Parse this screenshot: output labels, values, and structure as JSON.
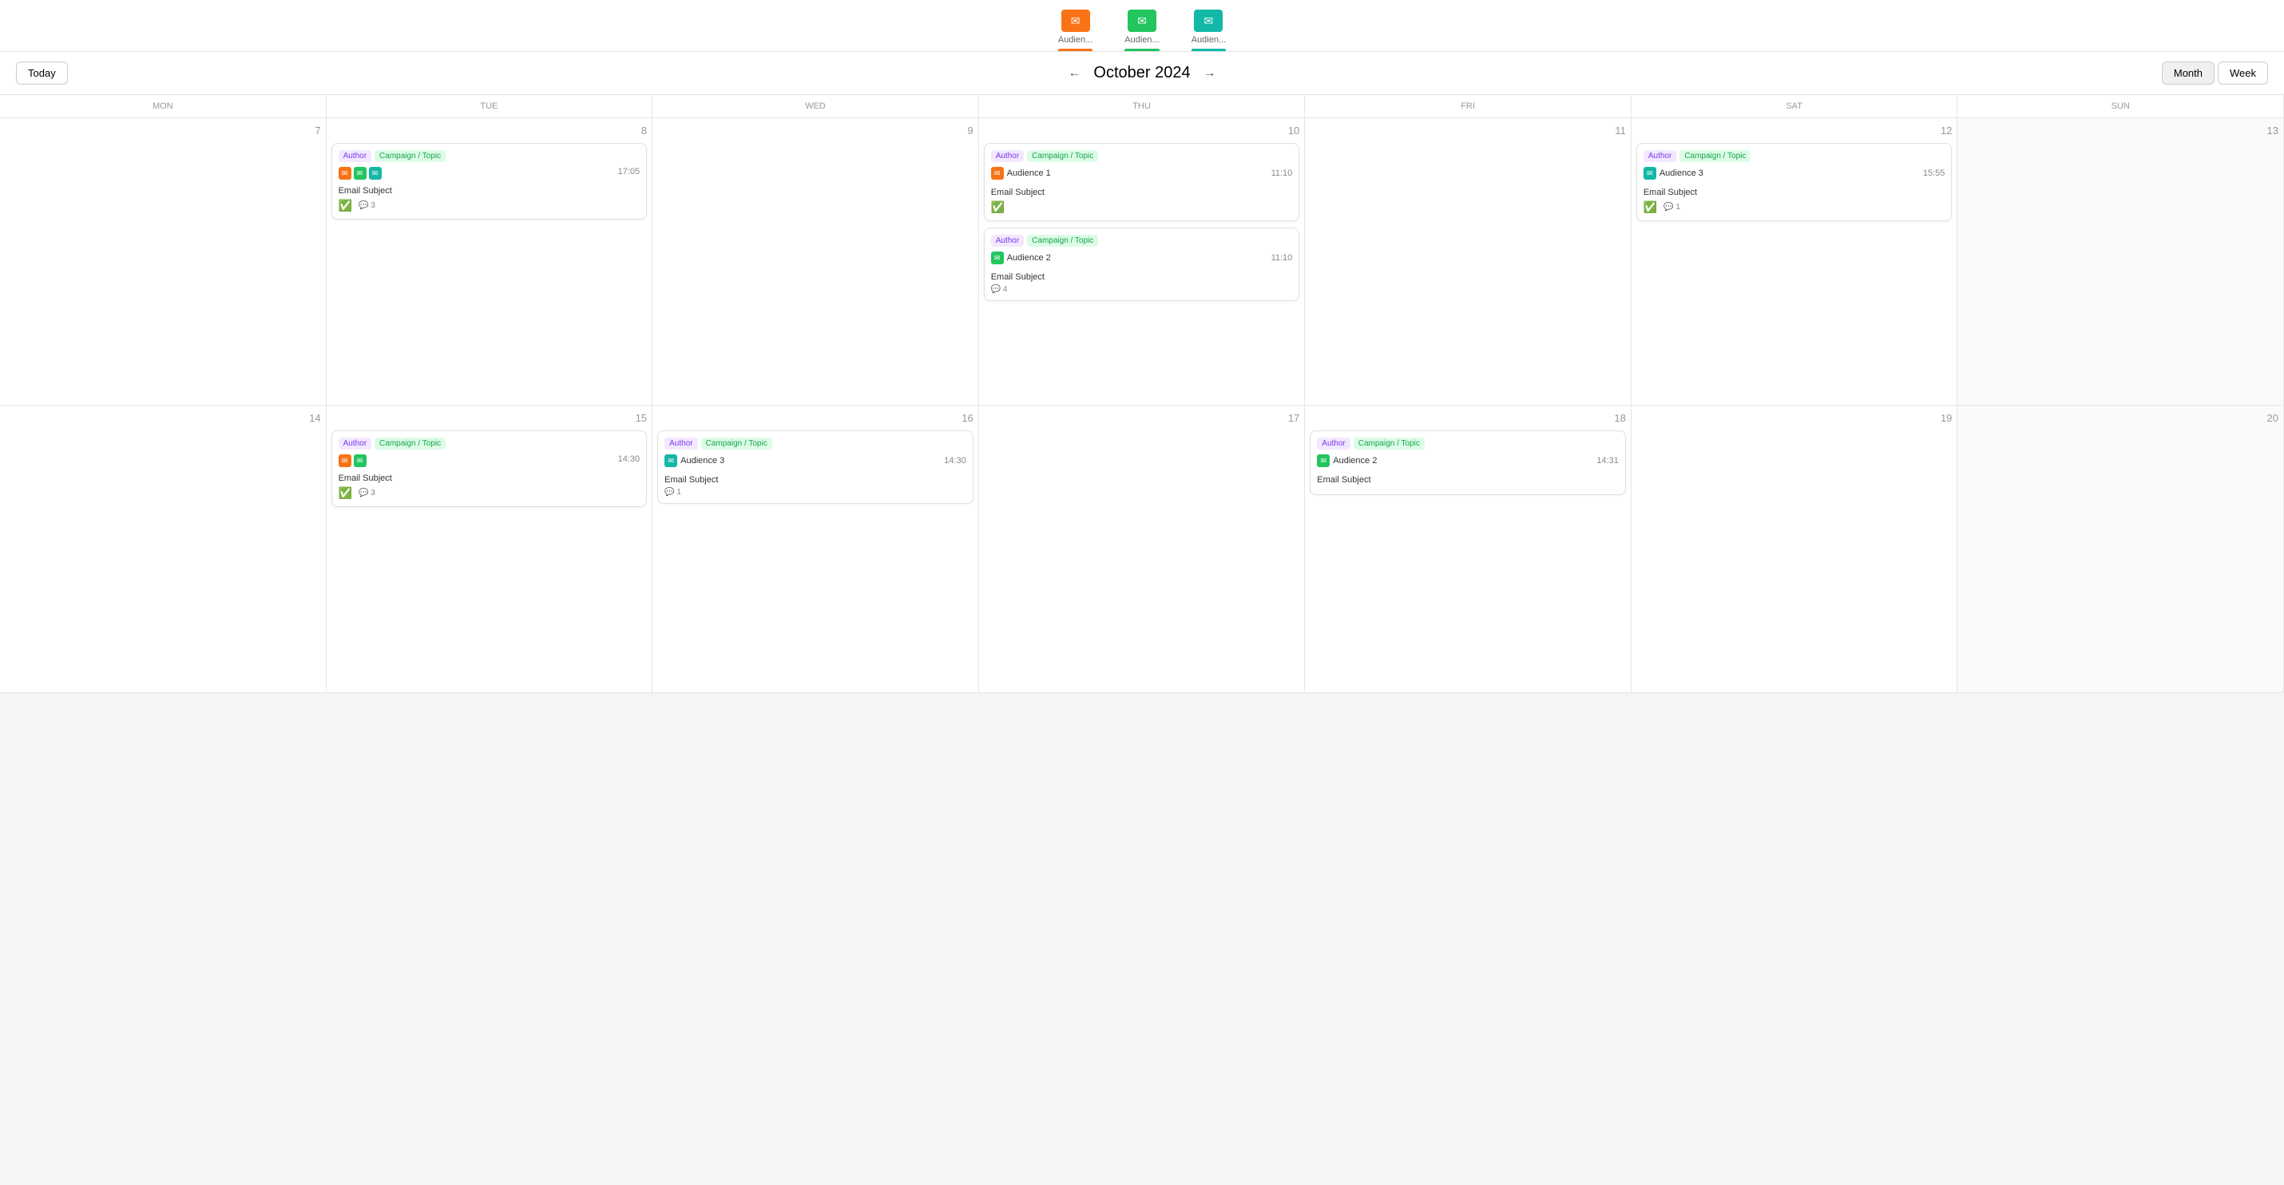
{
  "nav": {
    "items": [
      {
        "label": "Audien...",
        "iconClass": "orange",
        "activeClass": "active-orange"
      },
      {
        "label": "Audien...",
        "iconClass": "green",
        "activeClass": "active-green"
      },
      {
        "label": "Audien...",
        "iconClass": "teal",
        "activeClass": "active-teal"
      }
    ]
  },
  "header": {
    "today_label": "Today",
    "month": "October",
    "year": "2024",
    "month_year": "October 2024",
    "view_month": "Month",
    "view_week": "Week"
  },
  "days_of_week": [
    "MON",
    "TUE",
    "WED",
    "THU",
    "FRI",
    "SAT",
    "SUN"
  ],
  "row1": {
    "dates": [
      7,
      8,
      9,
      10,
      11,
      12,
      13
    ],
    "cards": {
      "tue8": [
        {
          "tags": [
            "Author",
            "Campaign / Topic"
          ],
          "icons": [
            "orange",
            "green",
            "teal"
          ],
          "time": "17:05",
          "audience": "",
          "subject": "Email Subject",
          "has_check": true,
          "comments": 3
        }
      ],
      "thu10": [
        {
          "tags": [
            "Author",
            "Campaign / Topic"
          ],
          "icons": [
            "orange"
          ],
          "time": "11:10",
          "audience": "Audience 1",
          "audience_icon": "orange",
          "subject": "Email Subject",
          "has_check": true,
          "comments": 0
        },
        {
          "tags": [
            "Author",
            "Campaign / Topic"
          ],
          "icons": [
            "green"
          ],
          "time": "11:10",
          "audience": "Audience 2",
          "audience_icon": "green",
          "subject": "Email Subject",
          "has_check": false,
          "comments": 4
        }
      ],
      "sat12": [
        {
          "tags": [
            "Author",
            "Campaign / Topic"
          ],
          "icons": [
            "teal"
          ],
          "time": "15:55",
          "audience": "Audience 3",
          "audience_icon": "teal",
          "subject": "Email Subject",
          "has_check": true,
          "comments": 1
        }
      ]
    }
  },
  "row2": {
    "dates": [
      14,
      15,
      16,
      17,
      18,
      19,
      20
    ],
    "cards": {
      "tue15": [
        {
          "tags": [
            "Author",
            "Campaign / Topic"
          ],
          "icons": [
            "orange",
            "green"
          ],
          "time": "14:30",
          "audience": "",
          "subject": "Email Subject",
          "has_check": true,
          "comments": 3
        }
      ],
      "wed16": [
        {
          "tags": [
            "Author",
            "Campaign / Topic"
          ],
          "icons": [
            "teal"
          ],
          "time": "14:30",
          "audience": "Audience 3",
          "audience_icon": "teal",
          "subject": "Email Subject",
          "has_check": false,
          "comments": 1
        }
      ],
      "fri18": [
        {
          "tags": [
            "Author",
            "Campaign / Topic"
          ],
          "icons": [
            "green"
          ],
          "time": "14:31",
          "audience": "Audience 2",
          "audience_icon": "green",
          "subject": "Email Subject",
          "has_check": false,
          "comments": 0
        }
      ]
    }
  },
  "tags": {
    "author_label": "Author",
    "campaign_label": "Campaign / Topic"
  }
}
